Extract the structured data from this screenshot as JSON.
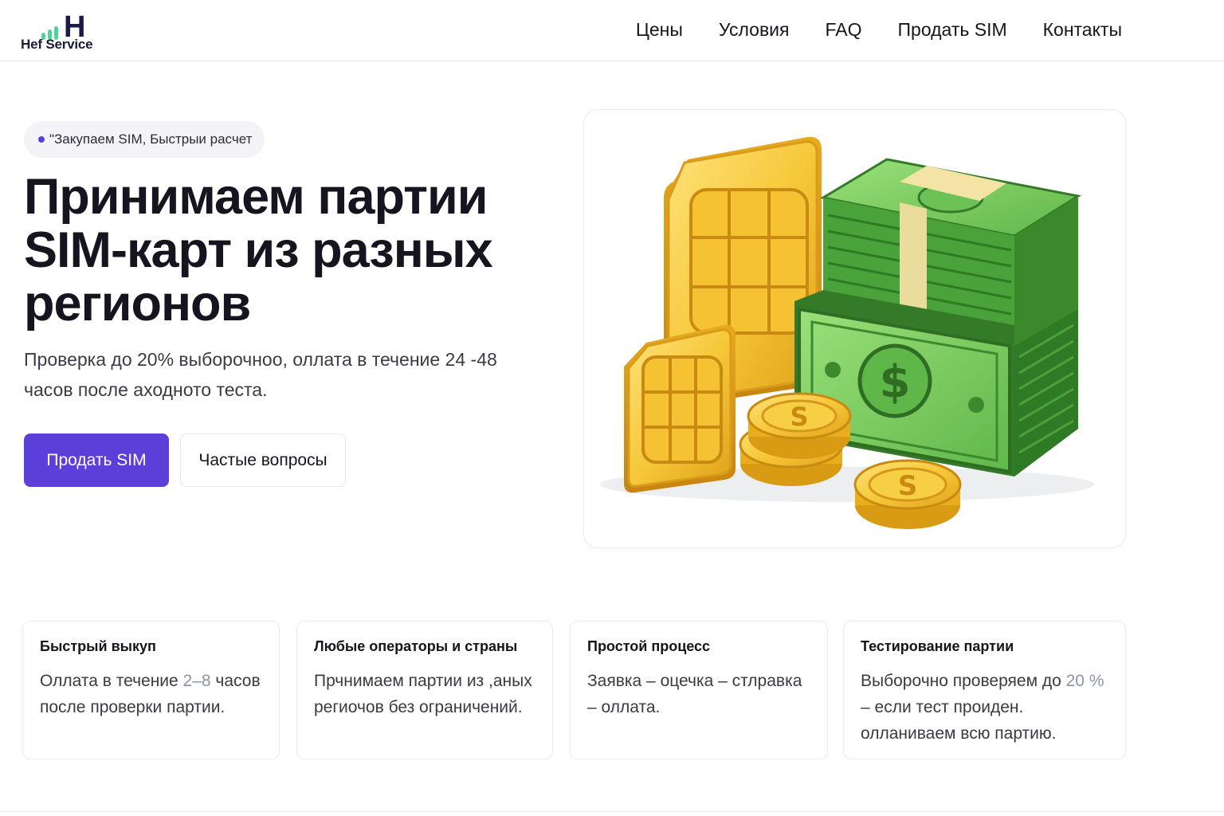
{
  "brand": {
    "logo_letter": "H",
    "name": "Hef Service",
    "accent": "#5b3fd8",
    "logo_bar_color": "#4fd39a"
  },
  "nav": {
    "items": [
      {
        "label": "Цены"
      },
      {
        "label": "Условия"
      },
      {
        "label": "FAQ"
      },
      {
        "label": "Продать SIM"
      },
      {
        "label": "Контакты"
      }
    ]
  },
  "hero": {
    "badge": "\"Закупаем SIM, Быстрыи расчет",
    "title": "Принимаем партии SIM-карт из разных регионов",
    "subtitle": "Проверка до 20% выборочноо, оллата в течение 24 -48 часов после аходното теста.",
    "primary_button": "Продать SIM",
    "secondary_button": "Частые вопросы",
    "image_icon": "sim-cards-and-money-illustration"
  },
  "features": [
    {
      "title": "Быстрый выкуп",
      "text_before": "Оллата в течение ",
      "highlight": "2–8",
      "text_after": " часов после проверки партии."
    },
    {
      "title": "Любые операторы и страны",
      "text_before": "Прчнимаем партии из ,аных региочов без ограничений.",
      "highlight": "",
      "text_after": ""
    },
    {
      "title": "Простой процесс",
      "text_before": "Заявка – оцечка – стлравка – оллата.",
      "highlight": "",
      "text_after": ""
    },
    {
      "title": "Тестирование партии",
      "text_before": "Выборочно проверяем до ",
      "highlight": "20 %",
      "text_after": " – если тест проиден. олланиваем всю партию."
    }
  ]
}
